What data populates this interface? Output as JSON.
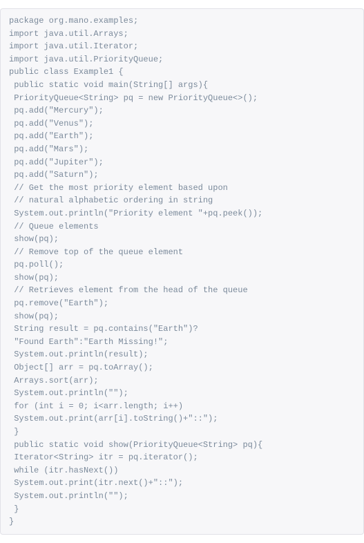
{
  "code": {
    "lines": [
      "package org.mano.examples;",
      "import java.util.Arrays;",
      "import java.util.Iterator;",
      "import java.util.PriorityQueue;",
      "public class Example1 {",
      " public static void main(String[] args){",
      " PriorityQueue<String> pq = new PriorityQueue<>();",
      " pq.add(\"Mercury\");",
      " pq.add(\"Venus\");",
      " pq.add(\"Earth\");",
      " pq.add(\"Mars\");",
      " pq.add(\"Jupiter\");",
      " pq.add(\"Saturn\");",
      " // Get the most priority element based upon",
      " // natural alphabetic ordering in string",
      " System.out.println(\"Priority element \"+pq.peek());",
      " // Queue elements",
      " show(pq);",
      " // Remove top of the queue element",
      " pq.poll();",
      " show(pq);",
      " // Retrieves element from the head of the queue",
      " pq.remove(\"Earth\");",
      " show(pq);",
      " String result = pq.contains(\"Earth\")?",
      " \"Found Earth\":\"Earth Missing!\";",
      " System.out.println(result);",
      " Object[] arr = pq.toArray();",
      " Arrays.sort(arr);",
      " System.out.println(\"\");",
      " for (int i = 0; i<arr.length; i++)",
      " System.out.print(arr[i].toString()+\"::\");",
      " }",
      " public static void show(PriorityQueue<String> pq){",
      " Iterator<String> itr = pq.iterator();",
      " while (itr.hasNext())",
      " System.out.print(itr.next()+\"::\");",
      " System.out.println(\"\");",
      " }",
      "}"
    ]
  }
}
